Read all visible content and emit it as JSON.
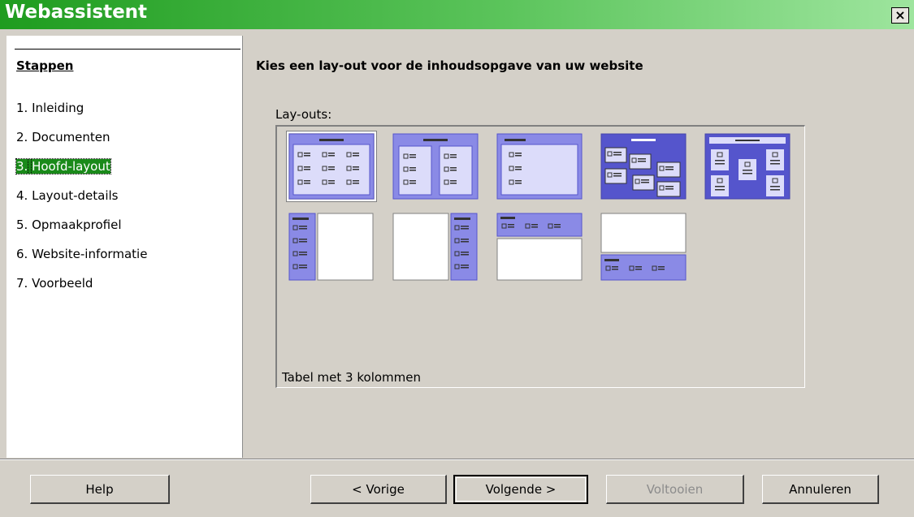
{
  "window": {
    "title": "Webassistent",
    "close_glyph": "×"
  },
  "sidebar": {
    "heading": "Stappen",
    "steps": [
      {
        "num": "1.",
        "label": "Inleiding"
      },
      {
        "num": "2.",
        "label": "Documenten"
      },
      {
        "num": "3.",
        "label": "Hoofd-layout"
      },
      {
        "num": "4.",
        "label": "Layout-details"
      },
      {
        "num": "5.",
        "label": "Opmaakprofiel"
      },
      {
        "num": "6.",
        "label": "Website-informatie"
      },
      {
        "num": "7.",
        "label": "Voorbeeld"
      }
    ],
    "active_step": 3
  },
  "main": {
    "heading": "Kies een lay-out voor de inhoudsopgave van uw website",
    "layouts_label": "Lay-outs:",
    "selected_caption": "Tabel met 3 kolommen"
  },
  "buttons": {
    "help": "Help",
    "back": "< Vorige",
    "next": "Volgende >",
    "finish": "Voltooien",
    "cancel": "Annuleren"
  },
  "colors": {
    "accent": "#1f9c1f",
    "thumb_fill": "#8a8ae6",
    "thumb_dark": "#5555cc"
  }
}
